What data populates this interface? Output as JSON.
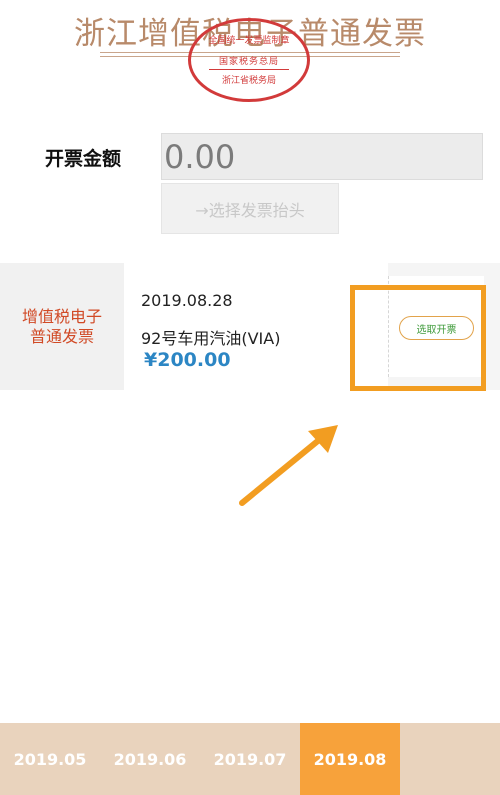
{
  "header": {
    "title": "浙江增值税电子普通发票",
    "seal": {
      "top": "全国统一发票监制章",
      "middle": "国家税务总局",
      "bottom": "浙江省税务局"
    }
  },
  "amount": {
    "label": "开票金额",
    "value": "0.00"
  },
  "choose_header_button": "→选择发票抬头",
  "invoice": {
    "type_line1": "增值税电子",
    "type_line2": "普通发票",
    "date": "2019.08.28",
    "item": "92号车用汽油(VIA)",
    "price": "¥200.00",
    "select_button": "选取开票"
  },
  "tabs": [
    {
      "label": "2019.05"
    },
    {
      "label": "2019.06"
    },
    {
      "label": "2019.07"
    },
    {
      "label": "2019.08"
    }
  ],
  "colors": {
    "accent": "#f7a23b",
    "annotation": "#f29d21",
    "price": "#2c86c4",
    "invoice_type": "#d14a26",
    "seal": "#d23a3a"
  }
}
